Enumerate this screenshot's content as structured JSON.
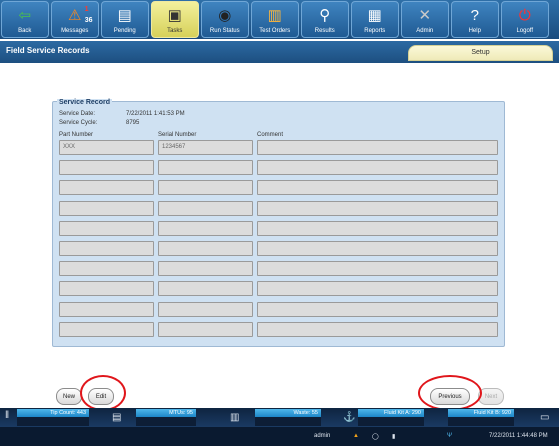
{
  "toolbar": {
    "buttons": [
      {
        "label": "Back",
        "icon": "back-arrow-icon",
        "glyph": "⇦",
        "color": "#4cc24a"
      },
      {
        "label": "Messages",
        "icon": "warning-icon",
        "glyph": "⚠",
        "color": "#ff8a1c",
        "badge_alert": "1",
        "badge_count": "36"
      },
      {
        "label": "Pending",
        "icon": "pending-icon",
        "glyph": "▤",
        "color": "#ffffff"
      },
      {
        "label": "Tasks",
        "icon": "clipboard-icon",
        "glyph": "▣",
        "color": "#333333"
      },
      {
        "label": "Run Status",
        "icon": "disc-icon",
        "glyph": "◉",
        "color": "#222222"
      },
      {
        "label": "Test Orders",
        "icon": "test-orders-icon",
        "glyph": "▥",
        "color": "#ffb73a"
      },
      {
        "label": "Results",
        "icon": "magnifier-icon",
        "glyph": "⚲",
        "color": "#ffffff"
      },
      {
        "label": "Reports",
        "icon": "report-icon",
        "glyph": "▦",
        "color": "#ffffff"
      },
      {
        "label": "Admin",
        "icon": "tools-icon",
        "glyph": "✕",
        "color": "#c9c9c9"
      },
      {
        "label": "Help",
        "icon": "help-icon",
        "glyph": "?",
        "color": "#ffffff"
      },
      {
        "label": "Logoff",
        "icon": "power-icon",
        "glyph": "⏻",
        "color": "#ff3030"
      }
    ]
  },
  "page": {
    "title": "Field Service Records",
    "tab_label": "Setup"
  },
  "record": {
    "title": "Service Record",
    "date_label": "Service Date:",
    "date_value": "7/22/2011 1:41:53 PM",
    "cycle_label": "Service Cycle:",
    "cycle_value": "8795",
    "columns": [
      "Part Number",
      "Serial Number",
      "Comment"
    ],
    "rows": [
      [
        "XXX",
        "1234567",
        ""
      ],
      [
        "",
        "",
        ""
      ],
      [
        "",
        "",
        ""
      ],
      [
        "",
        "",
        ""
      ],
      [
        "",
        "",
        ""
      ],
      [
        "",
        "",
        ""
      ],
      [
        "",
        "",
        ""
      ],
      [
        "",
        "",
        ""
      ],
      [
        "",
        "",
        ""
      ],
      [
        "",
        "",
        ""
      ]
    ]
  },
  "buttons": {
    "new": "New",
    "edit": "Edit",
    "previous": "Previous",
    "next": "Next"
  },
  "status": {
    "tip_count": "Tip Count: 443",
    "mtus": "MTUs: 95",
    "waste": "Waste: 55",
    "fluid_a": "Fluid Kit A: 290",
    "fluid_b": "Fluid Kit B: 920"
  },
  "footer": {
    "user": "admin",
    "datetime": "7/22/2011 1:44:48 PM"
  },
  "colors": {
    "highlight_circle": "#e0161b",
    "panel": "#cfe1f2",
    "toolbar": "#1f5a93"
  }
}
